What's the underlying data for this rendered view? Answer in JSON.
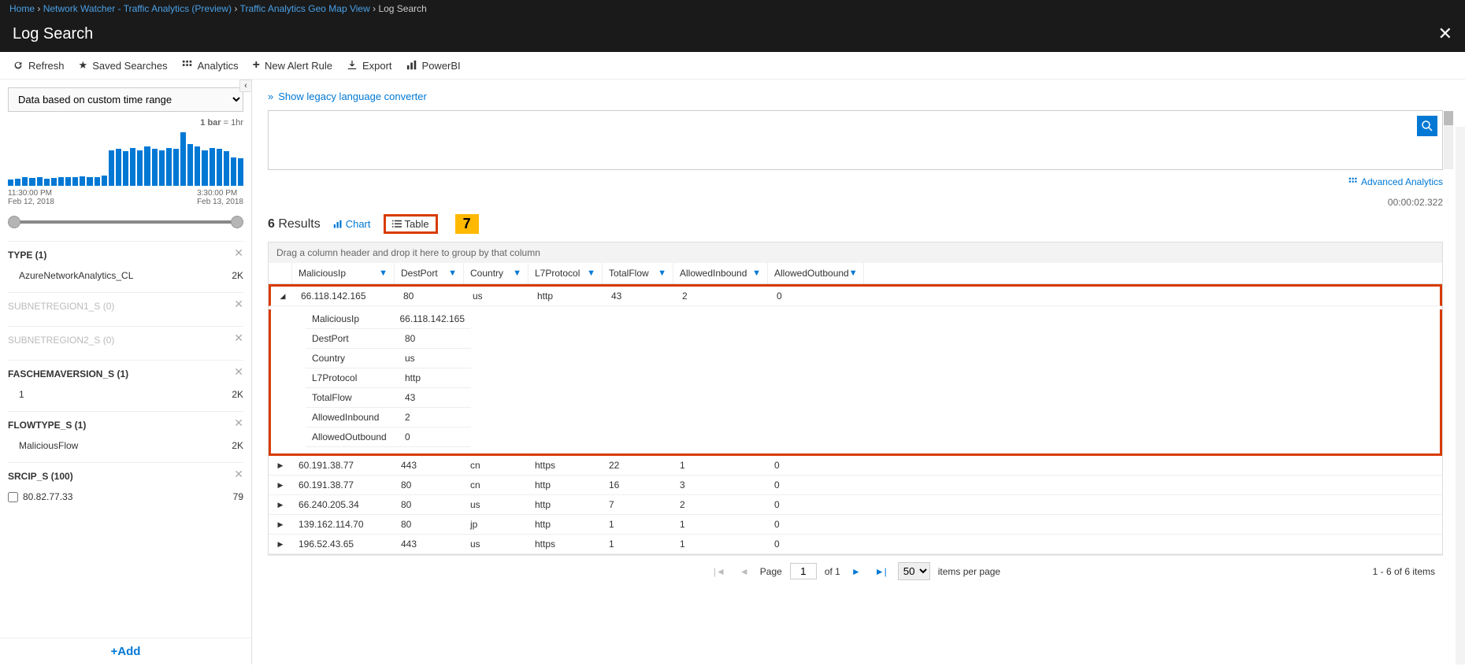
{
  "breadcrumb": {
    "items": [
      "Home",
      "Network Watcher - Traffic Analytics (Preview)",
      "Traffic Analytics Geo Map View",
      "Log Search"
    ],
    "current_idx": 3
  },
  "header": {
    "title": "Log Search"
  },
  "toolbar": {
    "refresh": "Refresh",
    "saved": "Saved Searches",
    "analytics": "Analytics",
    "alert": "New Alert Rule",
    "export": "Export",
    "powerbi": "PowerBI"
  },
  "sidebar": {
    "time_select": "Data based on custom time range",
    "bar_note_prefix": "1 bar",
    "bar_note_suffix": " = 1hr",
    "chart_axis": {
      "left_time": "11:30:00 PM",
      "left_date": "Feb 12, 2018",
      "right_time": "3:30:00 PM",
      "right_date": "Feb 13, 2018"
    },
    "facets": {
      "type": {
        "title": "TYPE  (1)",
        "items": [
          {
            "label": "AzureNetworkAnalytics_CL",
            "count": "2K"
          }
        ]
      },
      "subnet1": {
        "title": "SUBNETREGION1_S  (0)"
      },
      "subnet2": {
        "title": "SUBNETREGION2_S  (0)"
      },
      "faschema": {
        "title": "FASCHEMAVERSION_S  (1)",
        "items": [
          {
            "label": "1",
            "count": "2K"
          }
        ]
      },
      "flowtype": {
        "title": "FLOWTYPE_S  (1)",
        "items": [
          {
            "label": "MaliciousFlow",
            "count": "2K"
          }
        ]
      },
      "srcip": {
        "title": "SRCIP_S  (100)",
        "items": [
          {
            "label": "80.82.77.33",
            "count": "79"
          }
        ]
      }
    },
    "add": "+Add"
  },
  "content": {
    "lang_link": "Show legacy language converter",
    "adv_link": "Advanced Analytics",
    "timer": "00:00:02.322",
    "results_n": "6",
    "results_lbl": " Results",
    "chart_lbl": "Chart",
    "table_lbl": "Table",
    "callout": "7",
    "group_hint": "Drag a column header and drop it here to group by that column",
    "columns": [
      "MaliciousIp",
      "DestPort",
      "Country",
      "L7Protocol",
      "TotalFlow",
      "AllowedInbound",
      "AllowedOutbound"
    ],
    "rows": [
      {
        "expanded": true,
        "c": [
          "66.118.142.165",
          "80",
          "us",
          "http",
          "43",
          "2",
          "0"
        ]
      },
      {
        "expanded": false,
        "c": [
          "60.191.38.77",
          "443",
          "cn",
          "https",
          "22",
          "1",
          "0"
        ]
      },
      {
        "expanded": false,
        "c": [
          "60.191.38.77",
          "80",
          "cn",
          "http",
          "16",
          "3",
          "0"
        ]
      },
      {
        "expanded": false,
        "c": [
          "66.240.205.34",
          "80",
          "us",
          "http",
          "7",
          "2",
          "0"
        ]
      },
      {
        "expanded": false,
        "c": [
          "139.162.114.70",
          "80",
          "jp",
          "http",
          "1",
          "1",
          "0"
        ]
      },
      {
        "expanded": false,
        "c": [
          "196.52.43.65",
          "443",
          "us",
          "https",
          "1",
          "1",
          "0"
        ]
      }
    ],
    "detail": [
      {
        "k": "MaliciousIp",
        "v": "66.118.142.165"
      },
      {
        "k": "DestPort",
        "v": "80"
      },
      {
        "k": "Country",
        "v": "us"
      },
      {
        "k": "L7Protocol",
        "v": "http"
      },
      {
        "k": "TotalFlow",
        "v": "43"
      },
      {
        "k": "AllowedInbound",
        "v": "2"
      },
      {
        "k": "AllowedOutbound",
        "v": "0"
      }
    ],
    "pager": {
      "page_lbl": "Page",
      "page_val": "1",
      "of": "of 1",
      "perpage": "50",
      "perpage_lbl": "items per page",
      "total": "1 - 6 of 6 items"
    }
  },
  "chart_data": {
    "type": "bar",
    "title": "Query result histogram",
    "categories_from": "Feb 12, 2018 11:30:00 PM",
    "categories_to": "Feb 13, 2018 3:30:00 PM",
    "granularity": "1 bar = 1hr",
    "values": [
      10,
      12,
      14,
      13,
      15,
      12,
      13,
      14,
      15,
      14,
      16,
      15,
      14,
      17,
      60,
      62,
      58,
      64,
      60,
      66,
      62,
      60,
      64,
      62,
      90,
      70,
      66,
      60,
      64,
      62,
      58,
      48,
      46
    ]
  }
}
